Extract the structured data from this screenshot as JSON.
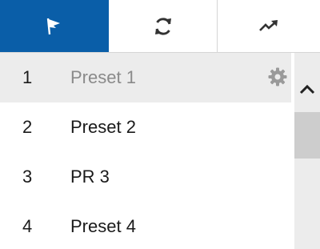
{
  "tabs": [
    {
      "id": "preset",
      "icon": "flag-icon",
      "active": true
    },
    {
      "id": "patrol",
      "icon": "refresh-icon",
      "active": false
    },
    {
      "id": "pattern",
      "icon": "trend-arrow-icon",
      "active": false
    }
  ],
  "presets": [
    {
      "number": "1",
      "name": "Preset 1",
      "selected": true
    },
    {
      "number": "2",
      "name": "Preset 2",
      "selected": false
    },
    {
      "number": "3",
      "name": "PR 3",
      "selected": false
    },
    {
      "number": "4",
      "name": "Preset 4",
      "selected": false
    }
  ],
  "colors": {
    "active_tab": "#0a5ea8",
    "selected_row": "#ececec",
    "selected_text": "#8a8a8a",
    "scrollbar_track": "#ececec",
    "scrollbar_thumb": "#cdcdcd"
  }
}
